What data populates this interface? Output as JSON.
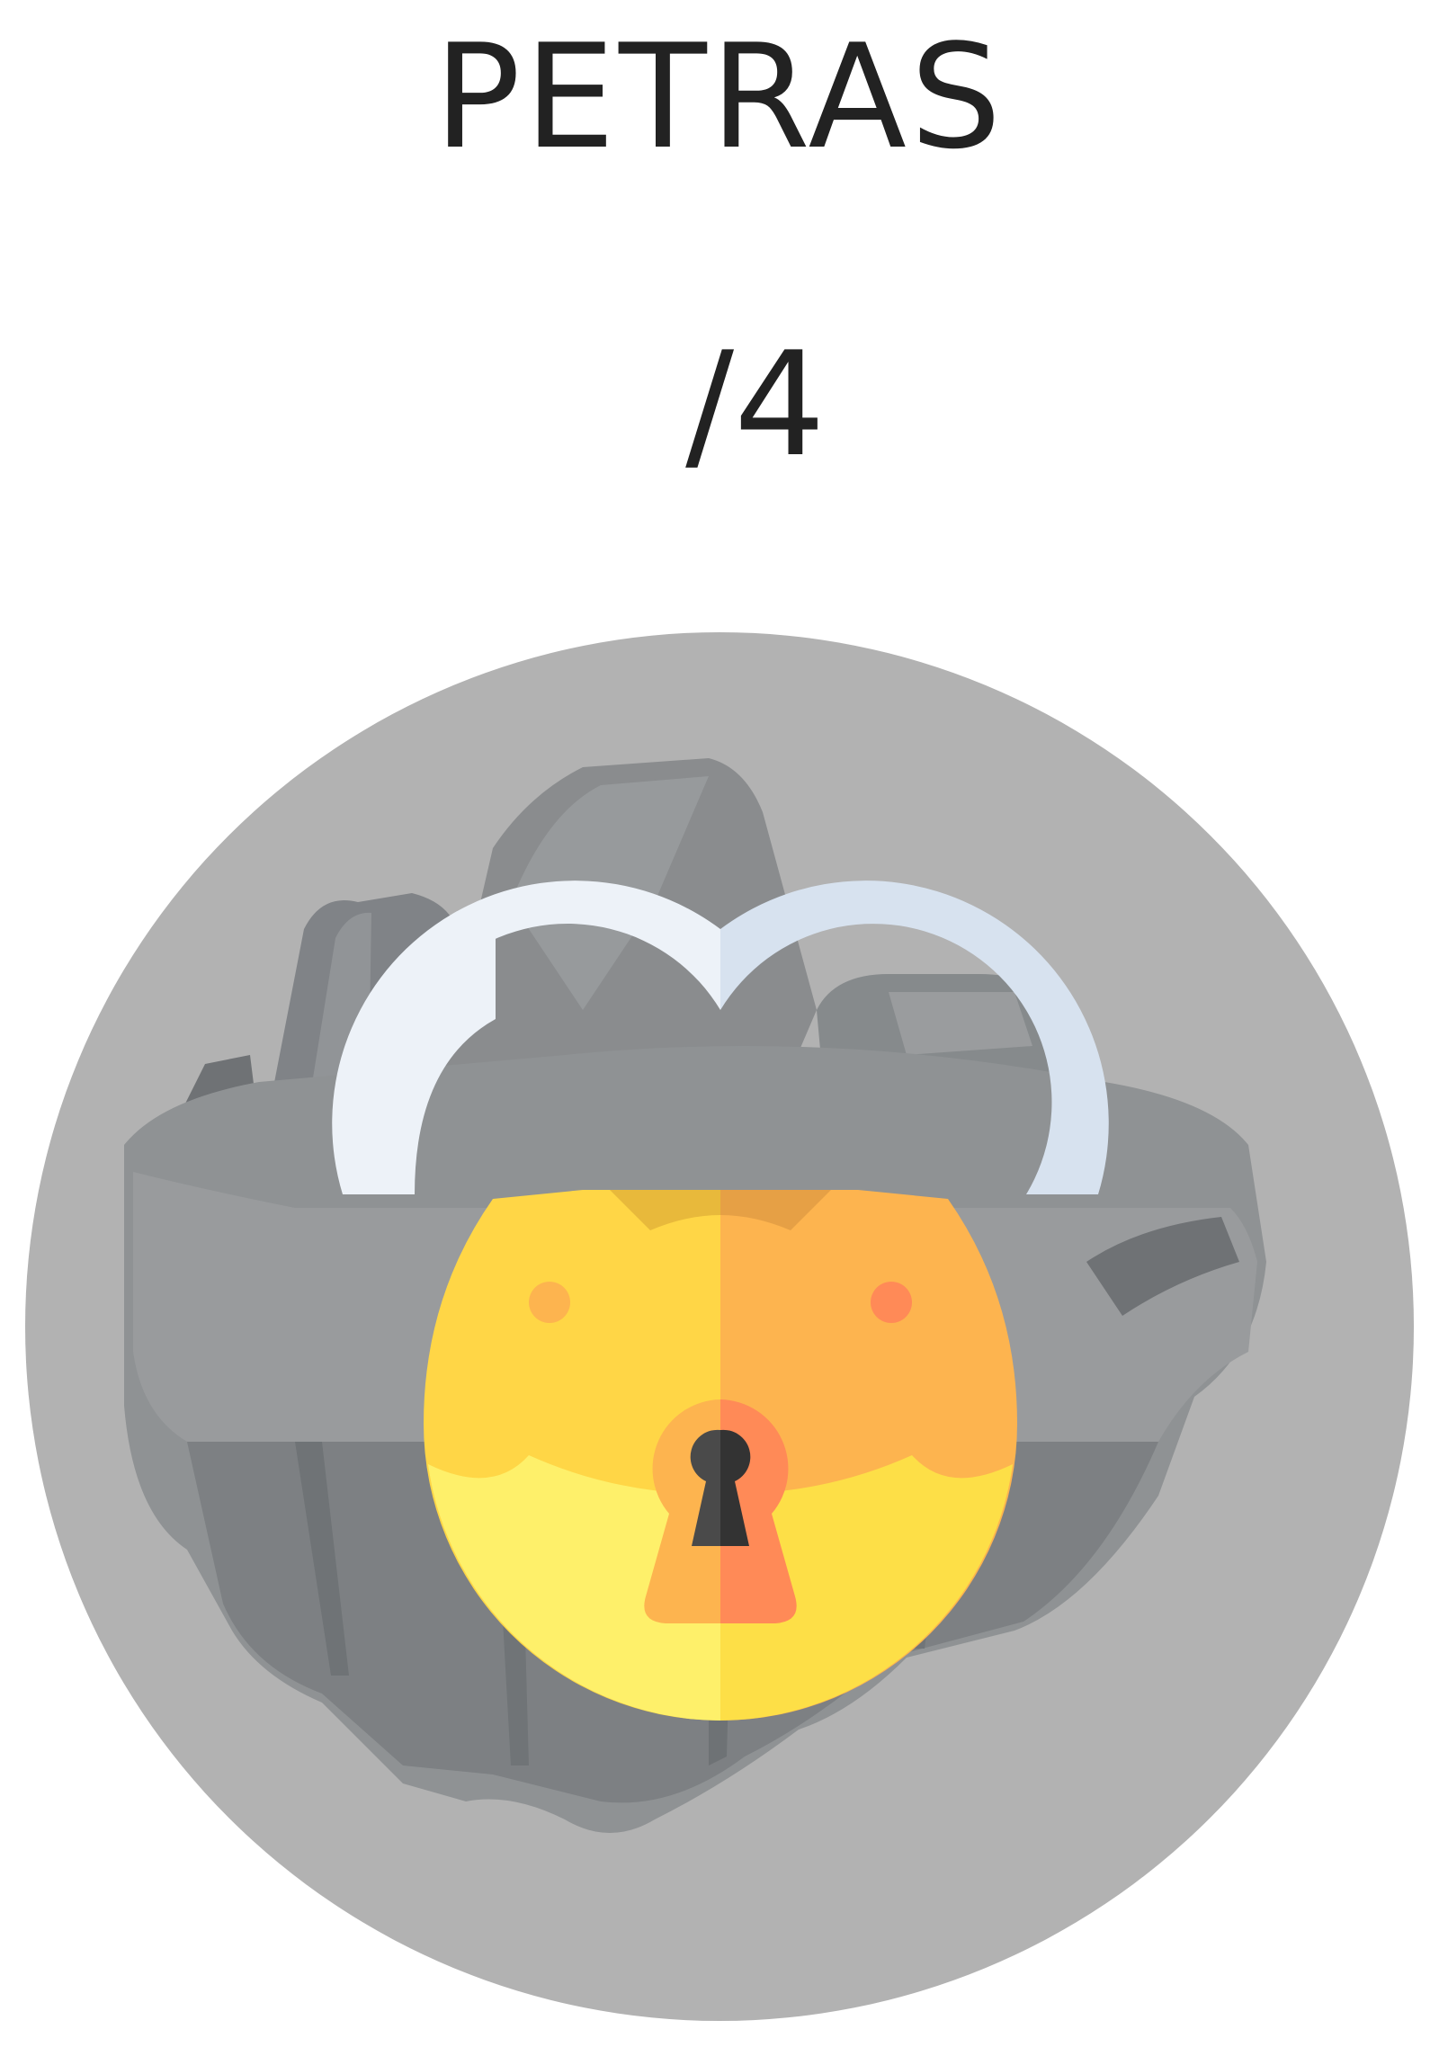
{
  "header": {
    "title": "PETRAS"
  },
  "progress": {
    "completed": "",
    "total_text": "/4"
  },
  "level": {
    "image": "stone-island-icon",
    "overlay_icon": "padlock-icon",
    "status": "locked",
    "colors": {
      "circle_background": "#b2b2b2",
      "rock": "#8a8c8e",
      "shackle": "#edf2f8",
      "lock_body_left": "#ffd646",
      "lock_body_right": "#fdb44f",
      "lock_lower": "#fef06a",
      "keyhole": "#ff8a57"
    }
  }
}
